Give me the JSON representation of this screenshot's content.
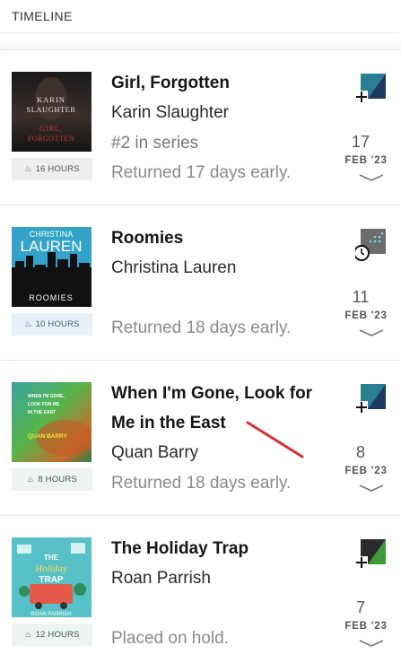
{
  "header": {
    "title": "TIMELINE"
  },
  "entries": [
    {
      "title": "Girl, Forgotten",
      "author": "Karin Slaughter",
      "series": "#2 in series",
      "status": "Returned 17 days early.",
      "duration": "16 HOURS",
      "day": "17",
      "month": "FEB '23",
      "cover_author": "KARIN SLAUGHTER",
      "cover_title": "GIRL, FORGOTTEN",
      "format_icon": "plus-teal-navy-icon"
    },
    {
      "title": "Roomies",
      "author": "Christina Lauren",
      "status": "Returned 18 days early.",
      "duration": "10 HOURS",
      "day": "11",
      "month": "FEB '23",
      "cover_author": "CHRISTINA LAUREN",
      "cover_title": "ROOMIES",
      "format_icon": "clock-grey-icon"
    },
    {
      "title": "When I'm Gone, Look for Me in the East",
      "author": "Quan Barry",
      "status": "Returned 18 days early.",
      "duration": "8 HOURS",
      "day": "8",
      "month": "FEB '23",
      "cover_title": "WHEN I'M GONE, LOOK FOR ME IN THE EAST",
      "cover_author": "QUAN BARRY",
      "format_icon": "plus-teal-navy-icon"
    },
    {
      "title": "The Holiday Trap",
      "author": "Roan Parrish",
      "status": "Placed on hold.",
      "duration": "12 HOURS",
      "day": "7",
      "month": "FEB '23",
      "cover_title": "THE Holiday TRAP",
      "cover_author": "ROAN PARRISH",
      "format_icon": "plus-dark-green-icon"
    }
  ],
  "colors": {
    "teal": "#2a7f92",
    "navy": "#1d3a5c",
    "green": "#3f9b3a",
    "dark": "#2b2b2b",
    "grey_icon": "#6c6c6c",
    "annotation_red": "#d93030"
  }
}
